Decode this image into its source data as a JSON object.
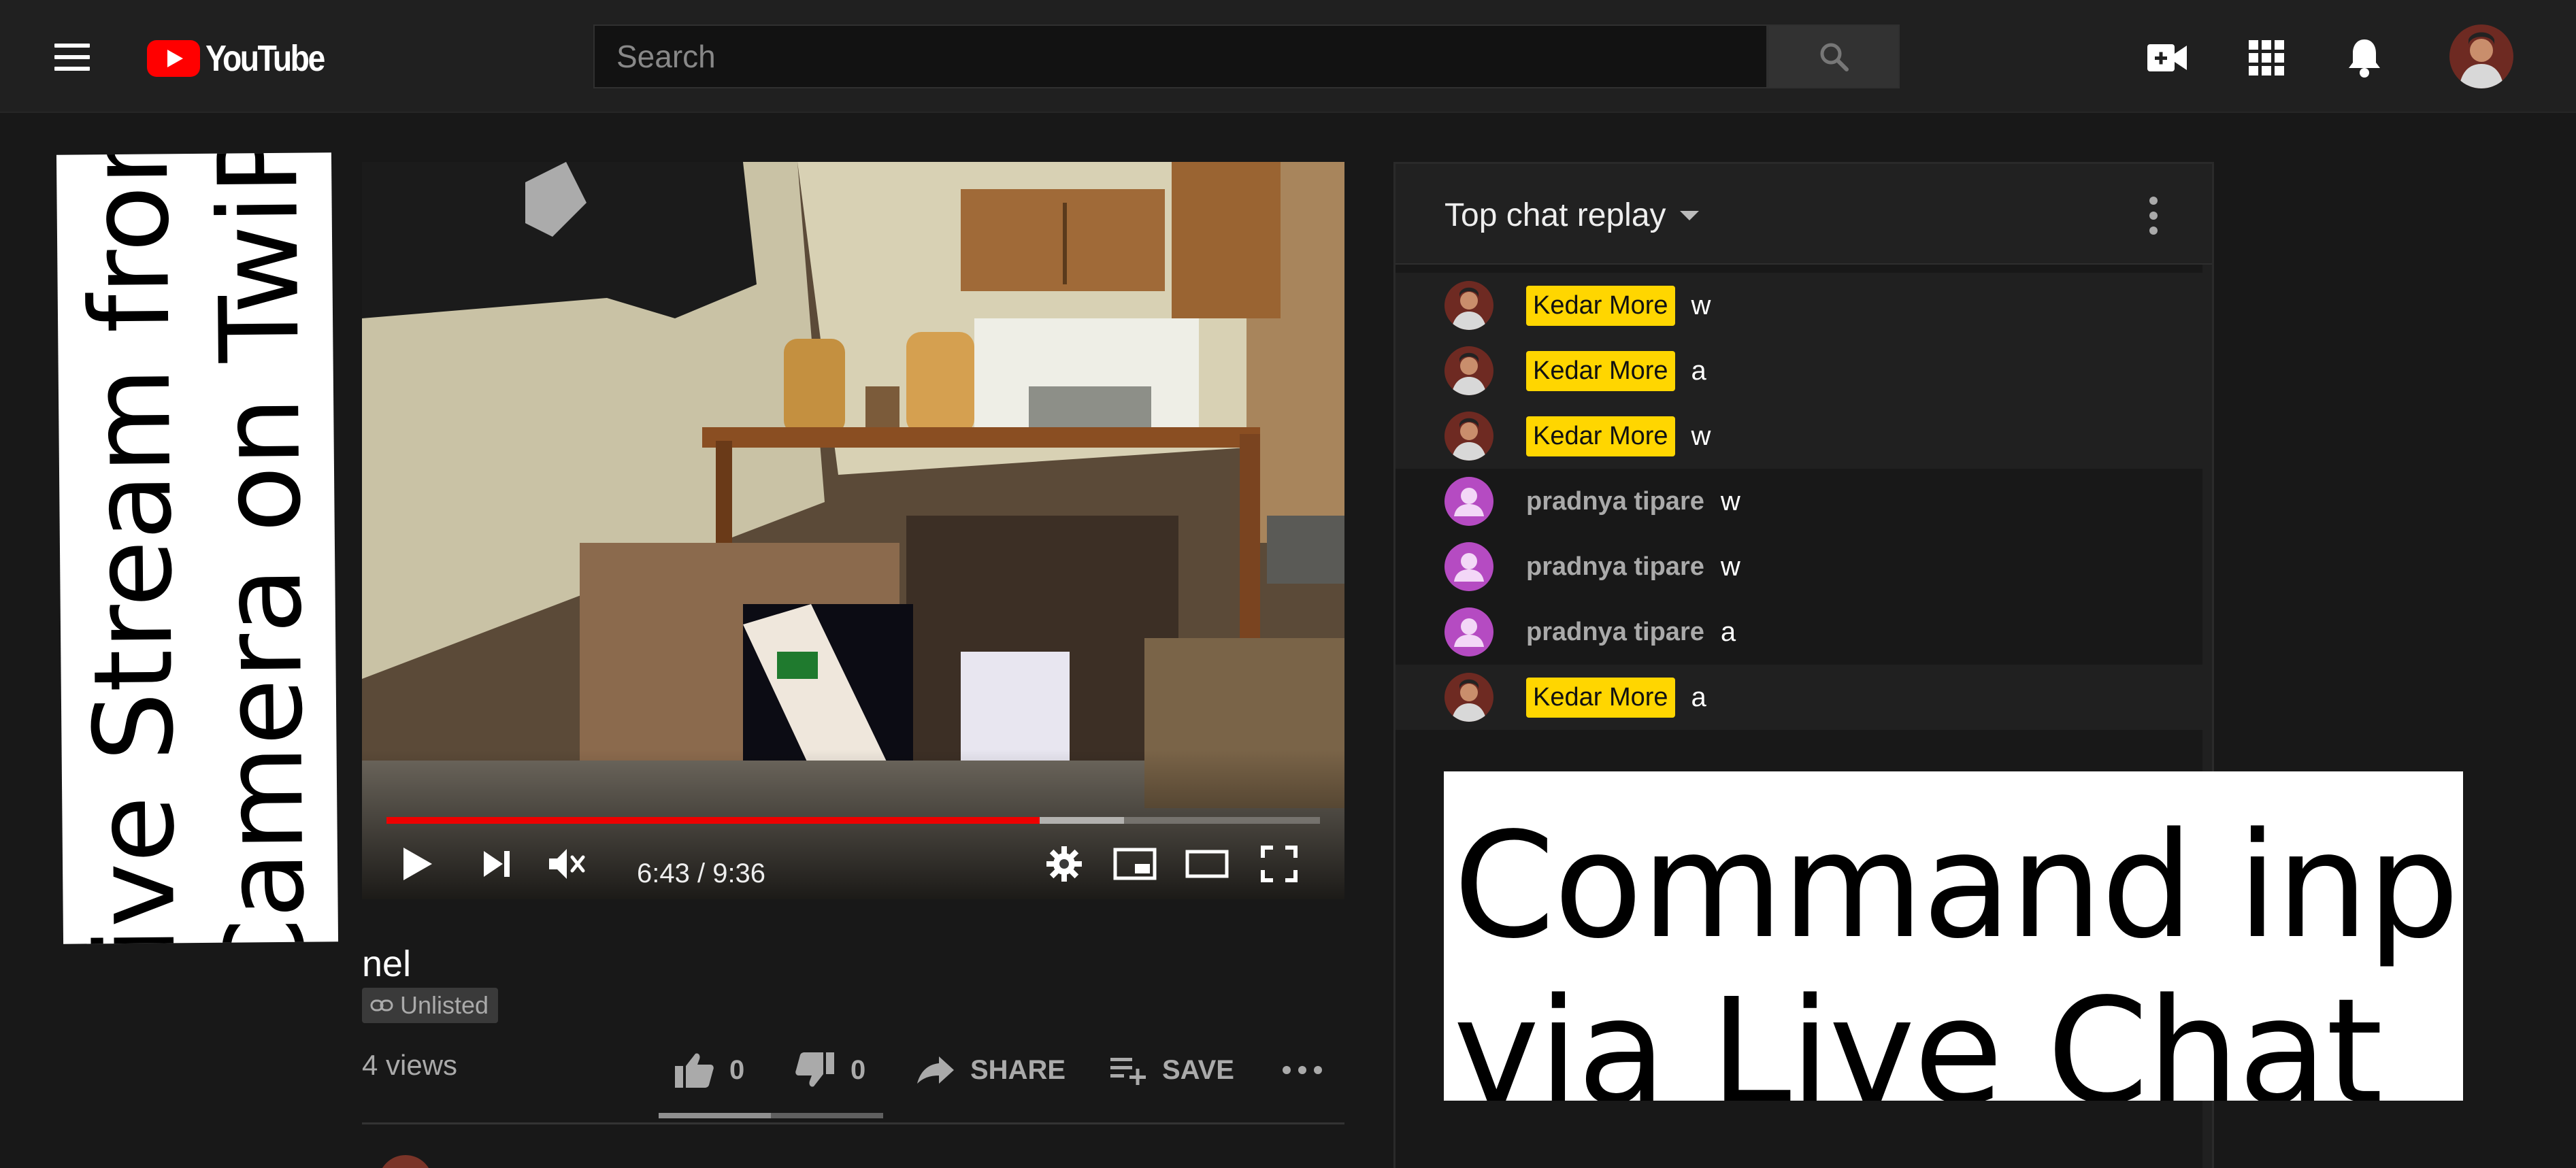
{
  "header": {
    "logo_text": "YouTube",
    "search_placeholder": "Search",
    "icons": [
      "menu-icon",
      "youtube-logo-icon",
      "search-icon",
      "create-video-icon",
      "apps-grid-icon",
      "notifications-bell-icon",
      "account-avatar"
    ]
  },
  "overlay_left": {
    "line1": "Live Stream from",
    "line2": "Camera on TwiPi"
  },
  "player": {
    "time": "6:43 / 9:36",
    "progress_fraction": 0.7,
    "buffered_fraction": 0.79,
    "progress_color": "#ee0000",
    "icons": [
      "play-icon",
      "next-icon",
      "volume-icon",
      "settings-gear-icon",
      "miniplayer-icon",
      "theater-mode-icon",
      "fullscreen-icon"
    ]
  },
  "video": {
    "title": "nel",
    "privacy": "Unlisted",
    "views": "4 views",
    "likes": "0",
    "dislikes": "0",
    "share_label": "SHARE",
    "save_label": "SAVE",
    "like_ratio_fraction": 0.5
  },
  "chat": {
    "mode_label": "Top chat replay",
    "owner_badge_color": "#ffd600",
    "messages": [
      {
        "author": "Kedar More",
        "text": "w",
        "owner": true
      },
      {
        "author": "Kedar More",
        "text": "a",
        "owner": true
      },
      {
        "author": "Kedar More",
        "text": "w",
        "owner": true
      },
      {
        "author": "pradnya tipare",
        "text": "w",
        "owner": false
      },
      {
        "author": "pradnya tipare",
        "text": "w",
        "owner": false
      },
      {
        "author": "pradnya tipare",
        "text": "a",
        "owner": false
      },
      {
        "author": "Kedar More",
        "text": "a",
        "owner": true
      }
    ]
  },
  "overlay_right": {
    "line1": "Command inputs",
    "line2": "via Live Chat"
  }
}
